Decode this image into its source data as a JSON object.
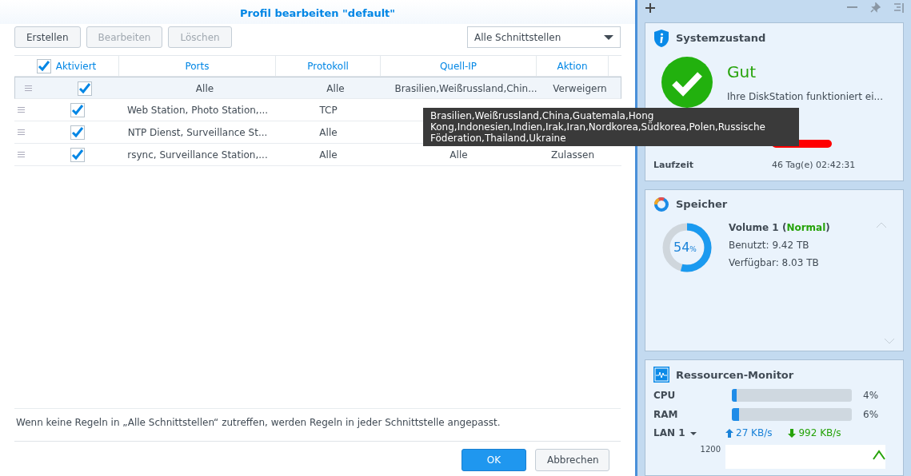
{
  "dialog": {
    "title": "Profil bearbeiten \"default\"",
    "toolbar": [
      {
        "label": "Erstellen",
        "disabled": false
      },
      {
        "label": "Bearbeiten",
        "disabled": true
      },
      {
        "label": "Löschen",
        "disabled": true
      }
    ],
    "interface_select": {
      "value": "Alle Schnittstellen"
    },
    "table": {
      "header_checked": true,
      "columns": [
        "Aktiviert",
        "Ports",
        "Protokoll",
        "Quell-IP",
        "Aktion"
      ],
      "rows": [
        {
          "checked": true,
          "selected": true,
          "ports": "Alle",
          "protocol": "Alle",
          "source_ip": "Brasilien,Weißrussland,Chin...",
          "action": "Verweigern"
        },
        {
          "checked": true,
          "selected": false,
          "ports": "Web Station, Photo Station,...",
          "protocol": "TCP"
        },
        {
          "checked": true,
          "selected": false,
          "ports": "NTP Dienst, Surveillance St...",
          "protocol": "Alle"
        },
        {
          "checked": true,
          "selected": false,
          "ports": "rsync, Surveillance Station,...",
          "protocol": "Alle",
          "source_ip": "Alle",
          "action": "Zulassen"
        }
      ]
    },
    "tooltip": "Brasilien,Weißrussland,China,Guatemala,Hong Kong,Indonesien,Indien,Irak,Iran,Nordkorea,Südkorea,Polen,Russische Föderation,Thailand,Ukraine",
    "note": "Wenn keine Regeln in „Alle Schnittstellen“ zutreffen, werden Regeln in jeder Schnittstelle angepasst.",
    "buttons": [
      {
        "label": "OK",
        "kind": "primary"
      },
      {
        "label": "Abbrechen",
        "kind": "secondary"
      }
    ]
  },
  "widgets": {
    "system": {
      "title": "Systemzustand",
      "status": "Gut",
      "message": "Ihre DiskStation funktioniert ei...",
      "rows": [
        {
          "redacted": true
        },
        {
          "label": "Laufzeit",
          "value": "46 Tag(e) 02:42:31",
          "redacted": false
        }
      ]
    },
    "storage": {
      "title": "Speicher",
      "level": 0.54,
      "percent": "54",
      "percent_unit": "%",
      "volume": "Volume 1 (**Normal**)",
      "used": "Benutzt: 9.42 TB",
      "free": "Verfügbar: 8.03 TB"
    },
    "monitor": {
      "title": "Ressourcen-Monitor",
      "meters": [
        {
          "name": "CPU",
          "level": 0.04,
          "reading": "4%"
        },
        {
          "name": "RAM",
          "level": 0.06,
          "reading": "6%"
        }
      ],
      "network": {
        "interface": "LAN 1",
        "upload": "27 KB/s",
        "download": "992 KB/s"
      },
      "graph_tick": "1200"
    }
  }
}
